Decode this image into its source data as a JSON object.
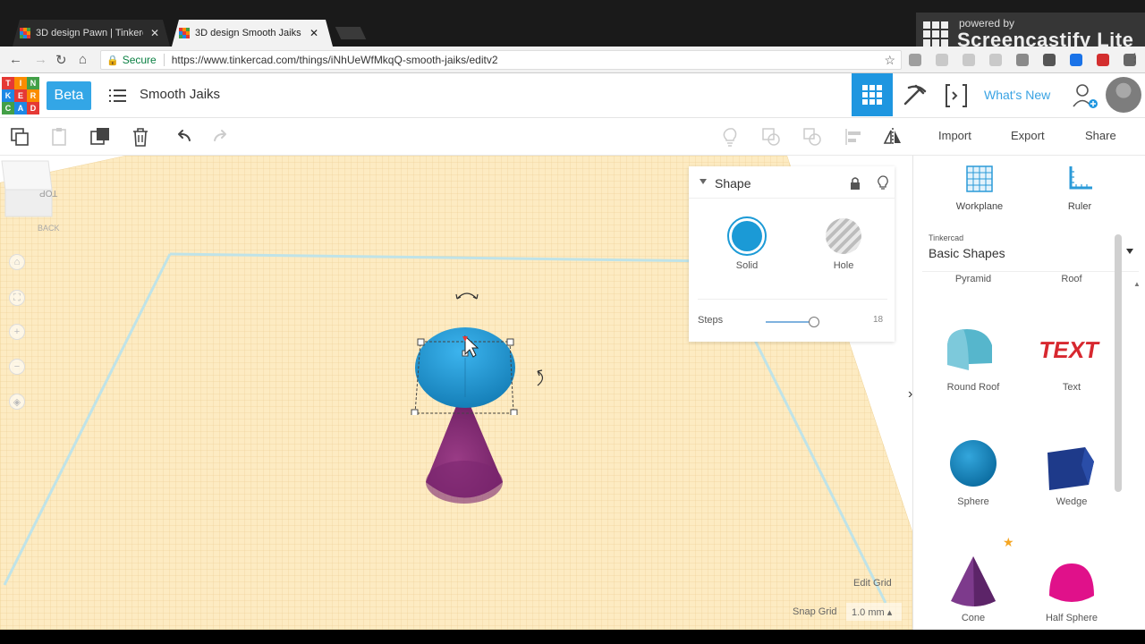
{
  "browser": {
    "tabs": [
      {
        "title": "3D design Pawn | Tinkerc",
        "close": "✕"
      },
      {
        "title": "3D design Smooth Jaiks",
        "close": "✕"
      }
    ],
    "secure_label": "Secure",
    "url": "https://www.tinkercad.com/things/iNhUeWfMkqQ-smooth-jaiks/editv2",
    "extension_colors": [
      "#9e9e9e",
      "#c9c9c9",
      "#c9c9c9",
      "#c9c9c9",
      "#8a8a8a",
      "#555555",
      "#1a73e8",
      "#d32f2f",
      "#666666"
    ]
  },
  "screencastify": {
    "powered_by": "powered by",
    "name": "Screencastify Lite"
  },
  "app": {
    "logo_letters": [
      "T",
      "I",
      "N",
      "K",
      "E",
      "R",
      "C",
      "A",
      "D"
    ],
    "logo_colors": [
      "#e53935",
      "#fb8c00",
      "#43a047",
      "#1e88e5",
      "#e53935",
      "#fb8c00",
      "#43a047",
      "#1e88e5",
      "#e53935"
    ],
    "beta": "Beta",
    "design_name": "Smooth Jaiks",
    "whats_new": "What's New",
    "accent": "#1e96e0"
  },
  "toolbar": {
    "import": "Import",
    "export": "Export",
    "share": "Share"
  },
  "viewcube": {
    "top": "TOP",
    "back": "BACK"
  },
  "workplane": {
    "edit_grid": "Edit Grid",
    "snap_grid": "Snap Grid",
    "snap_value": "1.0 mm ▴"
  },
  "inspector": {
    "title": "Shape",
    "solid": "Solid",
    "hole": "Hole",
    "steps_label": "Steps",
    "steps_value": "18",
    "solid_color": "#1b9ad6"
  },
  "panel": {
    "workplane": "Workplane",
    "ruler": "Ruler",
    "library_owner": "Tinkercad",
    "library_name": "Basic Shapes",
    "partial_top": [
      "Pyramid",
      "Roof"
    ],
    "shapes": [
      {
        "label": "Round Roof",
        "icon": "round-roof-icon"
      },
      {
        "label": "Text",
        "icon": "text-shape-icon"
      },
      {
        "label": "Sphere",
        "icon": "sphere-icon"
      },
      {
        "label": "Wedge",
        "icon": "wedge-icon"
      },
      {
        "label": "Cone",
        "icon": "cone-icon"
      },
      {
        "label": "Half Sphere",
        "icon": "half-sphere-icon"
      }
    ]
  }
}
